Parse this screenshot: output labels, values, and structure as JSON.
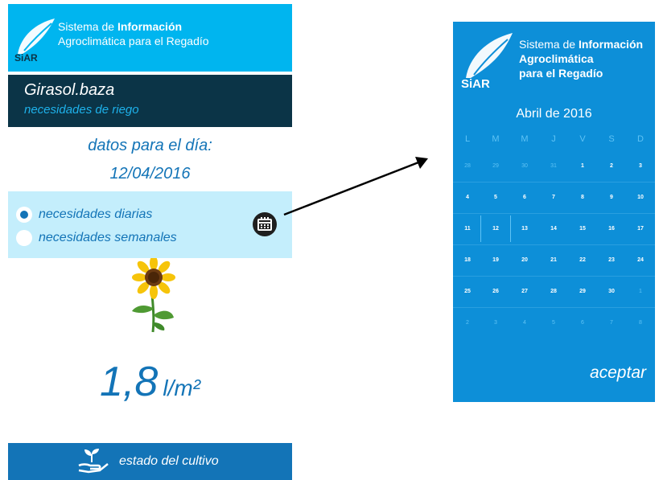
{
  "brand": {
    "line1_prefix": "Sistema de ",
    "line1_bold": "Información",
    "line2": "Agroclimática para el Regadío",
    "right_line2": "Agroclimática",
    "right_line3": "para el Regadío",
    "logo_text": "SiAR"
  },
  "crop": {
    "name": "Girasol.baza",
    "subtitle": "necesidades de riego"
  },
  "date": {
    "label": "datos para el día:",
    "value": "12/04/2016"
  },
  "options": [
    {
      "label": "necesidades diarias",
      "checked": true
    },
    {
      "label": "necesidades semanales",
      "checked": false
    }
  ],
  "amount": {
    "value": "1,8",
    "unit": "l/m²"
  },
  "bottom_button": {
    "label": "estado del cultivo"
  },
  "calendar": {
    "month_title": "Abril de 2016",
    "weekdays": [
      "L",
      "M",
      "M",
      "J",
      "V",
      "S",
      "D"
    ],
    "weeks": [
      [
        "28",
        "29",
        "30",
        "31",
        "1",
        "2",
        "3"
      ],
      [
        "4",
        "5",
        "6",
        "7",
        "8",
        "9",
        "10"
      ],
      [
        "11",
        "12",
        "13",
        "14",
        "15",
        "16",
        "17"
      ],
      [
        "18",
        "19",
        "20",
        "21",
        "22",
        "23",
        "24"
      ],
      [
        "25",
        "26",
        "27",
        "28",
        "29",
        "30",
        "1"
      ],
      [
        "2",
        "3",
        "4",
        "5",
        "6",
        "7",
        "8"
      ]
    ],
    "selected_day": "12",
    "accept_label": "aceptar"
  },
  "colors": {
    "header": "#00b5ef",
    "title_bar": "#0b3447",
    "accent_blue": "#1374b7",
    "options_bg": "#c4eefc",
    "calendar_bg": "#0d8fd8"
  }
}
